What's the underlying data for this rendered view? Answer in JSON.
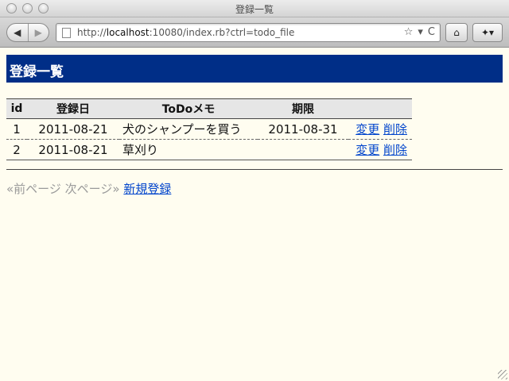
{
  "window": {
    "title": "登録一覧"
  },
  "toolbar": {
    "url_prefix": "http://",
    "url_host": "localhost",
    "url_rest": ":10080/index.rb?ctrl=todo_file",
    "back_icon": "◀",
    "forward_icon": "▶",
    "bookmark_star": "☆",
    "dropdown": "▾",
    "reload_icon": "C",
    "home_icon": "⌂",
    "bookmarks_icon": "✦▾"
  },
  "page": {
    "heading": "登録一覧",
    "table": {
      "headers": {
        "id": "id",
        "date": "登録日",
        "memo": "ToDoメモ",
        "limit": "期限"
      },
      "rows": [
        {
          "id": "1",
          "date": "2011-08-21",
          "memo": "犬のシャンプーを買う",
          "limit": "2011-08-31",
          "edit": "変更",
          "delete": "削除"
        },
        {
          "id": "2",
          "date": "2011-08-21",
          "memo": "草刈り",
          "limit": "",
          "edit": "変更",
          "delete": "削除"
        }
      ]
    },
    "pager": {
      "prev": "«前ページ",
      "next": "次ページ»",
      "new": "新規登録"
    }
  },
  "colors": {
    "heading_bg": "#002e87",
    "page_bg": "#fffdf0",
    "link": "#0044cc"
  }
}
